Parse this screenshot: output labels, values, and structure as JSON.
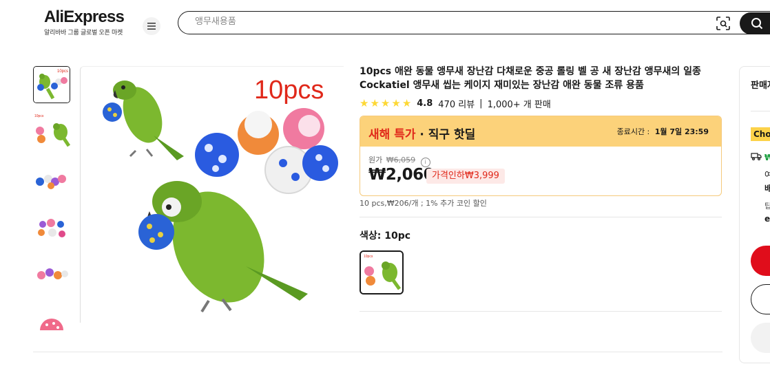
{
  "header": {
    "logo": "AliExpress",
    "logo_sub": "알리바바 그룹 글로벌 오픈 마켓",
    "search_placeholder": "앵무새용품"
  },
  "product": {
    "title": "10pcs 애완 동물 앵무새 장난감 다채로운 중공 롤링 벨 공 새 장난감 앵무새의 일종 Cockatiel 앵무새 씹는 케이지 재미있는 장난감 애완 동물 조류 용품",
    "rating": "4.8",
    "reviews": "470 리뷰",
    "sold": "1,000+ 개 판매",
    "image_label": "10pcs"
  },
  "deal": {
    "name_highlight": "새해 특가",
    "name_rest": "· 직구 핫딜",
    "end_label": "종료시간 :",
    "end_time": "1월 7일 23:59",
    "orig_label": "원가",
    "orig_price": "₩6,059",
    "price": "₩2,060",
    "discount": "가격인하₩3,999",
    "unit_info": "10 pcs,₩206/개 ; 1% 추가 코인 할인"
  },
  "color": {
    "label": "색상: 10pc"
  },
  "panel": {
    "seller": "판매자",
    "choice": "Choice",
    "price_prefix": "₩",
    "line1": "여",
    "line2": "배",
    "line3": "팁",
    "line4": "e"
  },
  "colors": {
    "brand_red": "#e00d1b",
    "deal_yellow": "#fcd27a",
    "discount_red": "#e0281a",
    "star": "#fdd835",
    "choice_yellow": "#fcd24a"
  }
}
